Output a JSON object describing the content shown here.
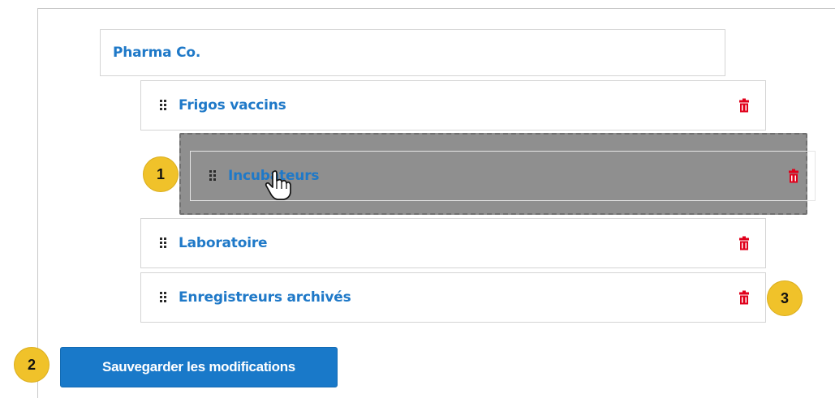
{
  "tree": {
    "root": {
      "label": "Pharma Co."
    },
    "items": [
      {
        "label": "Frigos vaccins",
        "icon": "drag-handle-icon",
        "action_icon": "trash-icon"
      },
      {
        "label": "Incubateurs",
        "icon": "drag-handle-icon",
        "action_icon": "trash-icon",
        "state": "dragging"
      },
      {
        "label": "Laboratoire",
        "icon": "drag-handle-icon",
        "action_icon": "trash-icon"
      },
      {
        "label": "Enregistreurs archivés",
        "icon": "drag-handle-icon",
        "action_icon": "trash-icon"
      }
    ]
  },
  "save_button": {
    "label": "Sauvegarder les modifications"
  },
  "callouts": [
    "1",
    "2",
    "3"
  ],
  "colors": {
    "link": "#1f79c8",
    "delete": "#e0001b",
    "primary_button": "#1979c9",
    "callout": "#f0c22a",
    "drag_placeholder": "#8f8f8f"
  }
}
